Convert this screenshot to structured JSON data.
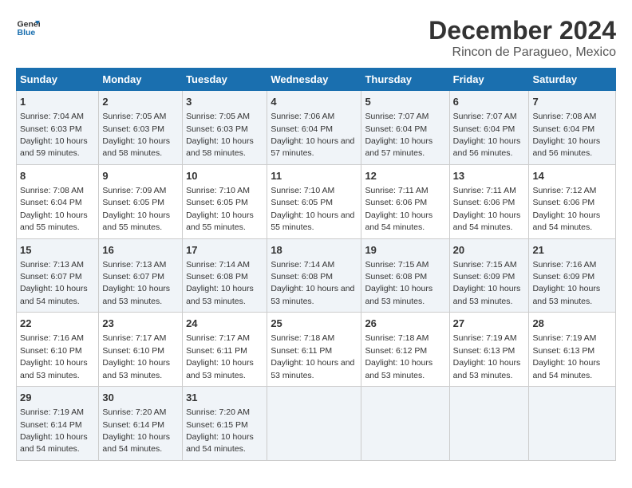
{
  "logo": {
    "line1": "General",
    "line2": "Blue"
  },
  "title": "December 2024",
  "subtitle": "Rincon de Paragueo, Mexico",
  "days_of_week": [
    "Sunday",
    "Monday",
    "Tuesday",
    "Wednesday",
    "Thursday",
    "Friday",
    "Saturday"
  ],
  "weeks": [
    [
      {
        "day": "1",
        "sunrise": "7:04 AM",
        "sunset": "6:03 PM",
        "daylight": "10 hours and 59 minutes."
      },
      {
        "day": "2",
        "sunrise": "7:05 AM",
        "sunset": "6:03 PM",
        "daylight": "10 hours and 58 minutes."
      },
      {
        "day": "3",
        "sunrise": "7:05 AM",
        "sunset": "6:03 PM",
        "daylight": "10 hours and 58 minutes."
      },
      {
        "day": "4",
        "sunrise": "7:06 AM",
        "sunset": "6:04 PM",
        "daylight": "10 hours and 57 minutes."
      },
      {
        "day": "5",
        "sunrise": "7:07 AM",
        "sunset": "6:04 PM",
        "daylight": "10 hours and 57 minutes."
      },
      {
        "day": "6",
        "sunrise": "7:07 AM",
        "sunset": "6:04 PM",
        "daylight": "10 hours and 56 minutes."
      },
      {
        "day": "7",
        "sunrise": "7:08 AM",
        "sunset": "6:04 PM",
        "daylight": "10 hours and 56 minutes."
      }
    ],
    [
      {
        "day": "8",
        "sunrise": "7:08 AM",
        "sunset": "6:04 PM",
        "daylight": "10 hours and 55 minutes."
      },
      {
        "day": "9",
        "sunrise": "7:09 AM",
        "sunset": "6:05 PM",
        "daylight": "10 hours and 55 minutes."
      },
      {
        "day": "10",
        "sunrise": "7:10 AM",
        "sunset": "6:05 PM",
        "daylight": "10 hours and 55 minutes."
      },
      {
        "day": "11",
        "sunrise": "7:10 AM",
        "sunset": "6:05 PM",
        "daylight": "10 hours and 55 minutes."
      },
      {
        "day": "12",
        "sunrise": "7:11 AM",
        "sunset": "6:06 PM",
        "daylight": "10 hours and 54 minutes."
      },
      {
        "day": "13",
        "sunrise": "7:11 AM",
        "sunset": "6:06 PM",
        "daylight": "10 hours and 54 minutes."
      },
      {
        "day": "14",
        "sunrise": "7:12 AM",
        "sunset": "6:06 PM",
        "daylight": "10 hours and 54 minutes."
      }
    ],
    [
      {
        "day": "15",
        "sunrise": "7:13 AM",
        "sunset": "6:07 PM",
        "daylight": "10 hours and 54 minutes."
      },
      {
        "day": "16",
        "sunrise": "7:13 AM",
        "sunset": "6:07 PM",
        "daylight": "10 hours and 53 minutes."
      },
      {
        "day": "17",
        "sunrise": "7:14 AM",
        "sunset": "6:08 PM",
        "daylight": "10 hours and 53 minutes."
      },
      {
        "day": "18",
        "sunrise": "7:14 AM",
        "sunset": "6:08 PM",
        "daylight": "10 hours and 53 minutes."
      },
      {
        "day": "19",
        "sunrise": "7:15 AM",
        "sunset": "6:08 PM",
        "daylight": "10 hours and 53 minutes."
      },
      {
        "day": "20",
        "sunrise": "7:15 AM",
        "sunset": "6:09 PM",
        "daylight": "10 hours and 53 minutes."
      },
      {
        "day": "21",
        "sunrise": "7:16 AM",
        "sunset": "6:09 PM",
        "daylight": "10 hours and 53 minutes."
      }
    ],
    [
      {
        "day": "22",
        "sunrise": "7:16 AM",
        "sunset": "6:10 PM",
        "daylight": "10 hours and 53 minutes."
      },
      {
        "day": "23",
        "sunrise": "7:17 AM",
        "sunset": "6:10 PM",
        "daylight": "10 hours and 53 minutes."
      },
      {
        "day": "24",
        "sunrise": "7:17 AM",
        "sunset": "6:11 PM",
        "daylight": "10 hours and 53 minutes."
      },
      {
        "day": "25",
        "sunrise": "7:18 AM",
        "sunset": "6:11 PM",
        "daylight": "10 hours and 53 minutes."
      },
      {
        "day": "26",
        "sunrise": "7:18 AM",
        "sunset": "6:12 PM",
        "daylight": "10 hours and 53 minutes."
      },
      {
        "day": "27",
        "sunrise": "7:19 AM",
        "sunset": "6:13 PM",
        "daylight": "10 hours and 53 minutes."
      },
      {
        "day": "28",
        "sunrise": "7:19 AM",
        "sunset": "6:13 PM",
        "daylight": "10 hours and 54 minutes."
      }
    ],
    [
      {
        "day": "29",
        "sunrise": "7:19 AM",
        "sunset": "6:14 PM",
        "daylight": "10 hours and 54 minutes."
      },
      {
        "day": "30",
        "sunrise": "7:20 AM",
        "sunset": "6:14 PM",
        "daylight": "10 hours and 54 minutes."
      },
      {
        "day": "31",
        "sunrise": "7:20 AM",
        "sunset": "6:15 PM",
        "daylight": "10 hours and 54 minutes."
      },
      null,
      null,
      null,
      null
    ]
  ]
}
